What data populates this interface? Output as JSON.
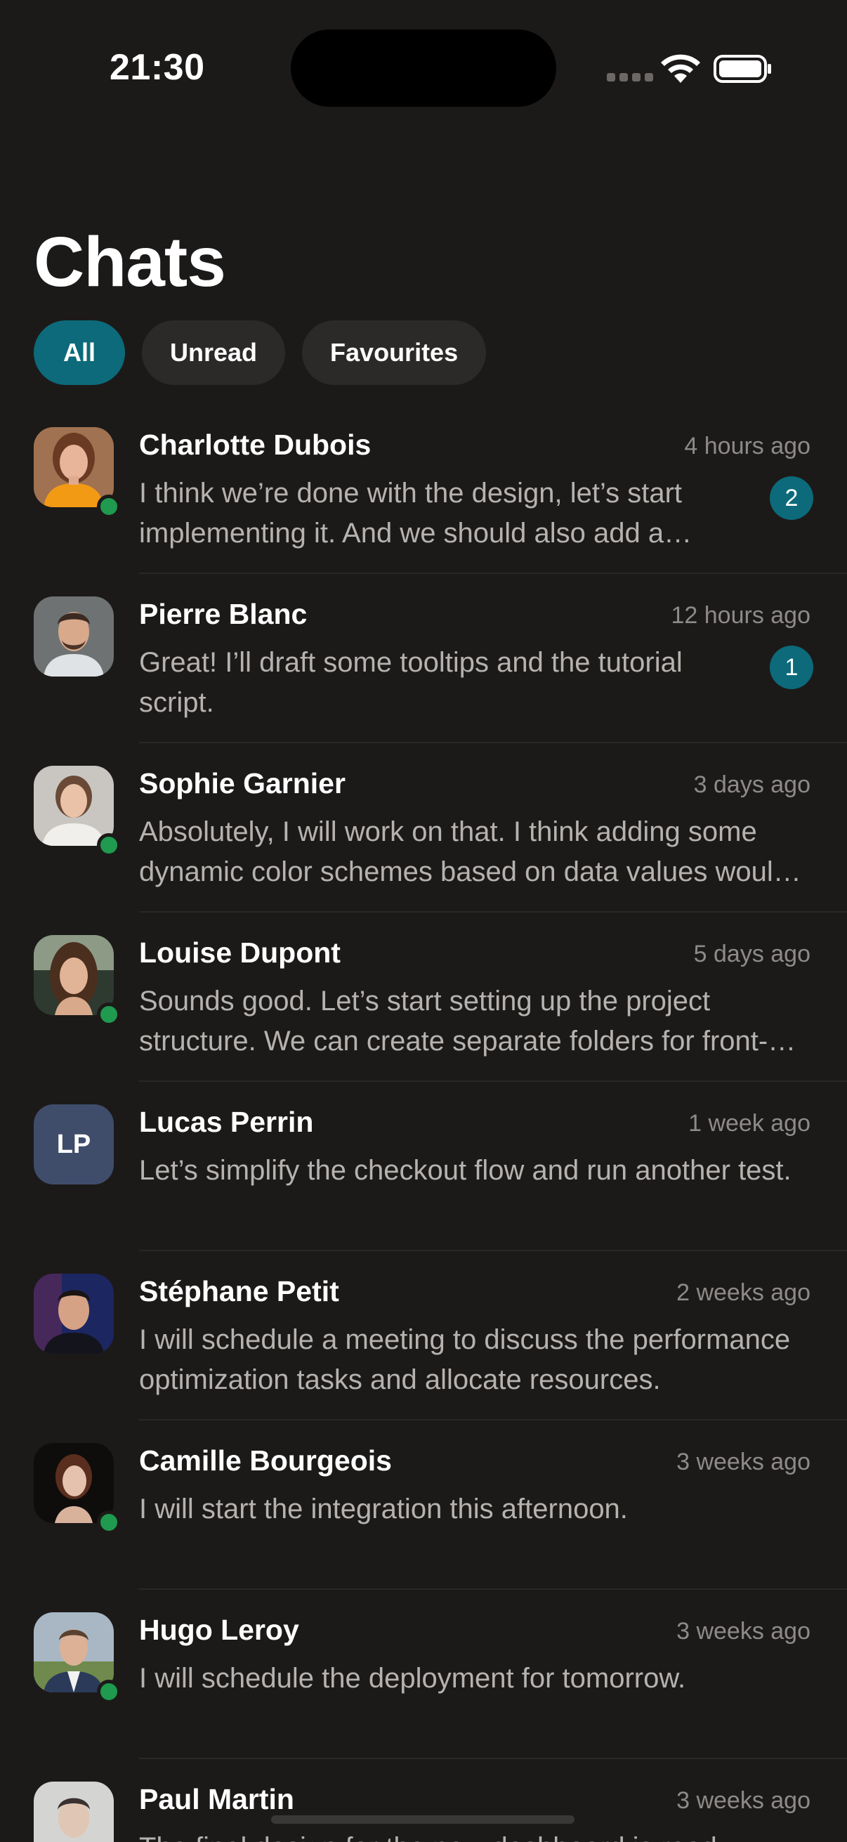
{
  "status_bar": {
    "time": "21:30"
  },
  "header": {
    "title": "Chats"
  },
  "filters": [
    {
      "label": "All",
      "active": true
    },
    {
      "label": "Unread",
      "active": false
    },
    {
      "label": "Favourites",
      "active": false
    }
  ],
  "colors": {
    "background": "#1c1a19",
    "accent": "#0c6a7a",
    "online": "#1f9a4e",
    "secondary_text": "#b5b2af",
    "timestamp": "#8d8a88"
  },
  "chats": [
    {
      "name": "Charlotte Dubois",
      "time": "4 hours ago",
      "message": "I think we’re done with the design, let’s start implementing it. And we should also add a loading state for the dashboard charts.",
      "unread": "2",
      "online": true,
      "avatar": "photo"
    },
    {
      "name": "Pierre Blanc",
      "time": "12 hours ago",
      "message": "Great! I’ll draft some tooltips and the tutorial script.",
      "unread": "1",
      "online": false,
      "avatar": "photo"
    },
    {
      "name": "Sophie Garnier",
      "time": "3 days ago",
      "message": "Absolutely, I will work on that. I think adding some dynamic color schemes based on data values would help.",
      "unread": "",
      "online": true,
      "avatar": "photo"
    },
    {
      "name": "Louise Dupont",
      "time": "5 days ago",
      "message": "Sounds good. Let’s start setting up the project structure. We can create separate folders for front-end and back-end.",
      "unread": "",
      "online": true,
      "avatar": "photo"
    },
    {
      "name": "Lucas Perrin",
      "time": "1 week ago",
      "message": "Let’s simplify the checkout flow and run another test.",
      "unread": "",
      "online": false,
      "avatar": "initials",
      "initials": "LP"
    },
    {
      "name": "Stéphane Petit",
      "time": "2 weeks ago",
      "message": "I will schedule a meeting to discuss the performance optimization tasks and allocate resources.",
      "unread": "",
      "online": false,
      "avatar": "photo"
    },
    {
      "name": "Camille Bourgeois",
      "time": "3 weeks ago",
      "message": "I will start the integration this afternoon.",
      "unread": "",
      "online": true,
      "avatar": "photo"
    },
    {
      "name": "Hugo Leroy",
      "time": "3 weeks ago",
      "message": "I will schedule the deployment for tomorrow.",
      "unread": "",
      "online": true,
      "avatar": "photo"
    },
    {
      "name": "Paul Martin",
      "time": "3 weeks ago",
      "message": "The final design for the new dashboard is ready.",
      "unread": "",
      "online": false,
      "avatar": "photo"
    }
  ]
}
